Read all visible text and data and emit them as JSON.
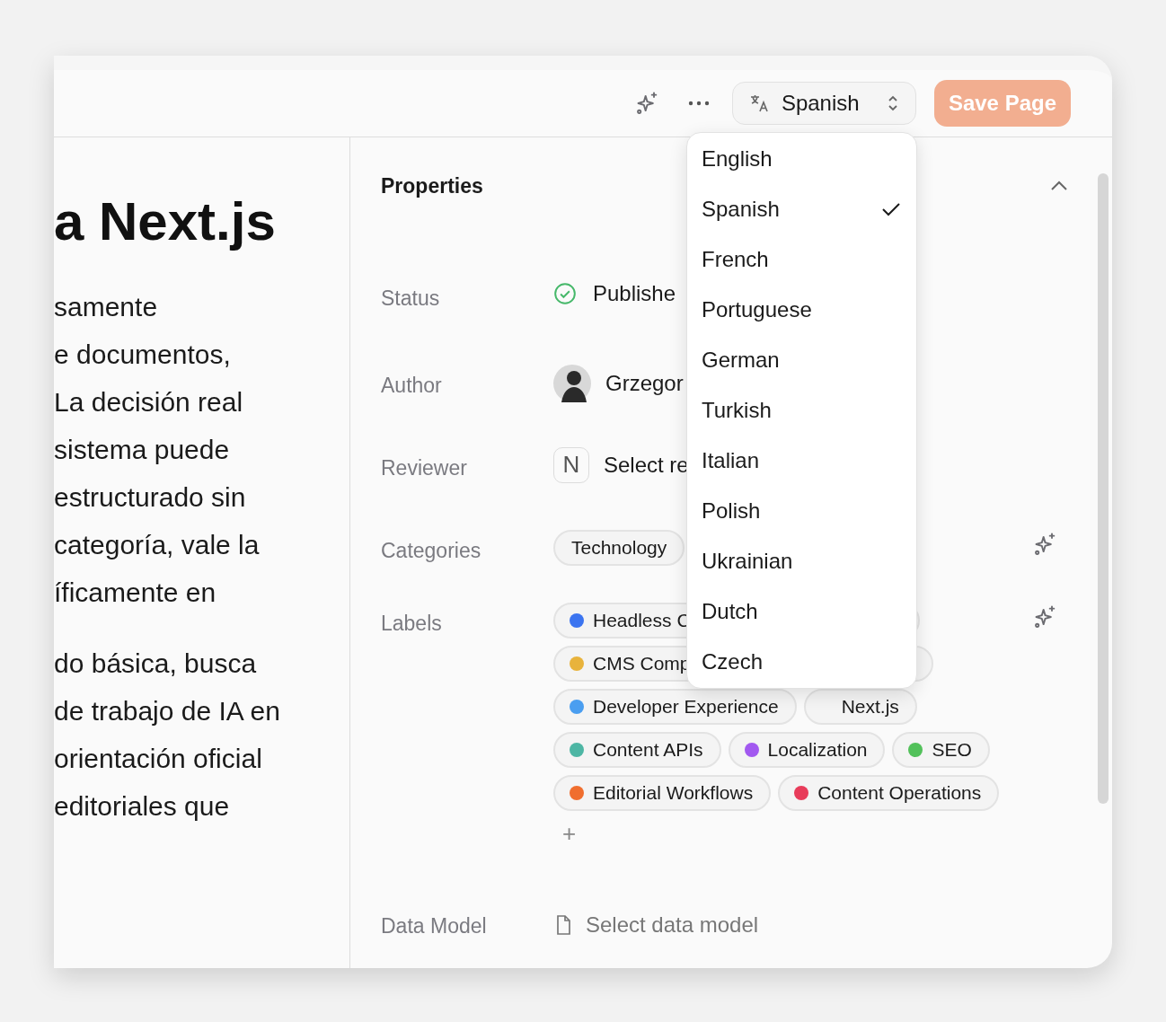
{
  "toolbar": {
    "language": "Spanish",
    "save_button": "Save Page"
  },
  "article": {
    "title": "a Next.js",
    "paragraphs": [
      [
        "samente",
        "e documentos,",
        "La decisión real",
        "sistema puede",
        "estructurado sin",
        "categoría, vale la",
        "íficamente en"
      ],
      [
        "do básica, busca",
        "de trabajo de IA en",
        "orientación oficial",
        "editoriales que"
      ]
    ]
  },
  "properties": {
    "title": "Properties",
    "expanded": true,
    "status": {
      "label": "Status",
      "value": "Publishe"
    },
    "author": {
      "label": "Author",
      "value": "Grzegor"
    },
    "reviewer": {
      "label": "Reviewer",
      "initial": "N",
      "value": "Select re"
    },
    "categories": {
      "label": "Categories",
      "items": [
        "Technology"
      ]
    },
    "labels": {
      "label": "Labels",
      "items": [
        {
          "text": "Headless C",
          "color": "#3b74f0"
        },
        {
          "text": "CMS Comp",
          "color": "#e8b33c"
        },
        {
          "text": "Developer Experience",
          "color": "#4a9ef0"
        },
        {
          "text": "Next.js"
        },
        {
          "text": "Content APIs",
          "color": "#4db6a4"
        },
        {
          "text": "Localization",
          "color": "#a259f0"
        },
        {
          "text": "SEO",
          "color": "#52c15a"
        },
        {
          "text": "Editorial Workflows",
          "color": "#f06e2e"
        },
        {
          "text": "Content Operations",
          "color": "#e83c5a"
        }
      ],
      "add": "+"
    },
    "data_model": {
      "label": "Data Model",
      "placeholder": "Select data model"
    }
  },
  "language_menu": [
    {
      "label": "English",
      "selected": false
    },
    {
      "label": "Spanish",
      "selected": true
    },
    {
      "label": "French",
      "selected": false
    },
    {
      "label": "Portuguese",
      "selected": false
    },
    {
      "label": "German",
      "selected": false
    },
    {
      "label": "Turkish",
      "selected": false
    },
    {
      "label": "Italian",
      "selected": false
    },
    {
      "label": "Polish",
      "selected": false
    },
    {
      "label": "Ukrainian",
      "selected": false
    },
    {
      "label": "Dutch",
      "selected": false
    },
    {
      "label": "Czech",
      "selected": false
    }
  ]
}
